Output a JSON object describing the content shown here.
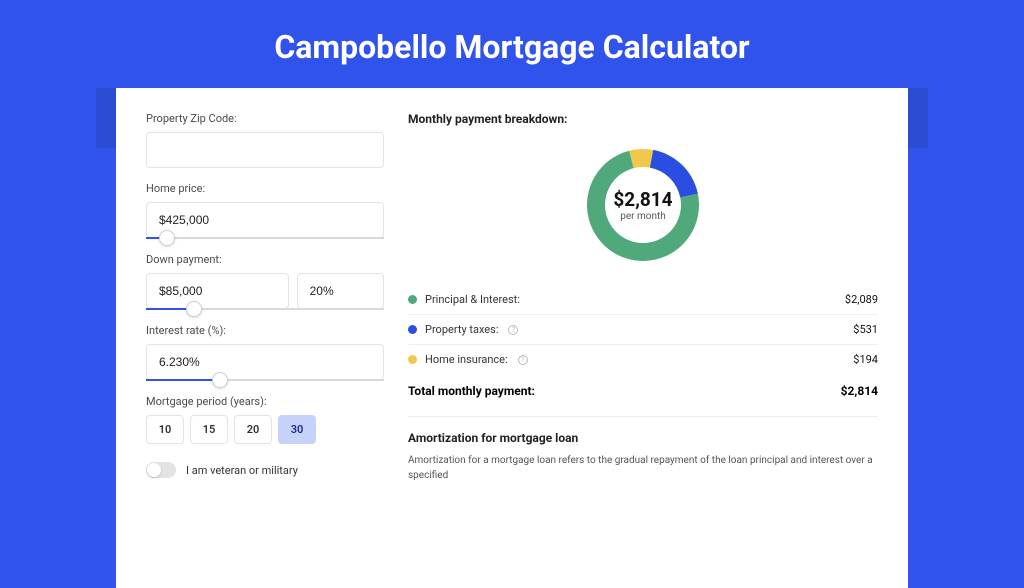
{
  "title": "Campobello Mortgage Calculator",
  "form": {
    "zip": {
      "label": "Property Zip Code:",
      "value": ""
    },
    "homePrice": {
      "label": "Home price:",
      "value": "$425,000",
      "sliderPct": 9
    },
    "downPayment": {
      "label": "Down payment:",
      "amount": "$85,000",
      "percent": "20%",
      "sliderPct": 20
    },
    "interestRate": {
      "label": "Interest rate (%):",
      "value": "6.230%",
      "sliderPct": 31
    },
    "period": {
      "label": "Mortgage period (years):",
      "options": [
        "10",
        "15",
        "20",
        "30"
      ],
      "active": "30"
    },
    "veteran": {
      "label": "I am veteran or military",
      "on": false
    }
  },
  "breakdown": {
    "heading": "Monthly payment breakdown:",
    "centerValue": "$2,814",
    "centerSub": "per month",
    "items": [
      {
        "label": "Principal & Interest:",
        "value": "$2,089",
        "color": "#4fa97b",
        "numeric": 2089,
        "info": false
      },
      {
        "label": "Property taxes:",
        "value": "$531",
        "color": "#2a4fe0",
        "numeric": 531,
        "info": true
      },
      {
        "label": "Home insurance:",
        "value": "$194",
        "color": "#efc94c",
        "numeric": 194,
        "info": true
      }
    ],
    "totalLabel": "Total monthly payment:",
    "totalValue": "$2,814"
  },
  "amortization": {
    "heading": "Amortization for mortgage loan",
    "text": "Amortization for a mortgage loan refers to the gradual repayment of the loan principal and interest over a specified"
  },
  "colors": {
    "accent": "#3053eb",
    "green": "#4fa97b",
    "blue": "#2a4fe0",
    "yellow": "#efc94c"
  },
  "chart_data": {
    "type": "pie",
    "title": "Monthly payment breakdown",
    "categories": [
      "Principal & Interest",
      "Property taxes",
      "Home insurance"
    ],
    "values": [
      2089,
      531,
      194
    ],
    "colors": [
      "#4fa97b",
      "#2a4fe0",
      "#efc94c"
    ],
    "total": 2814,
    "unit": "USD per month"
  }
}
